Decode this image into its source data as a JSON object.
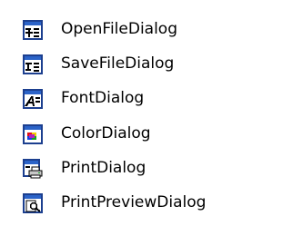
{
  "toolbox": {
    "items": [
      {
        "label": "OpenFileDialog",
        "icon": "open-file-dialog-icon"
      },
      {
        "label": "SaveFileDialog",
        "icon": "save-file-dialog-icon"
      },
      {
        "label": "FontDialog",
        "icon": "font-dialog-icon"
      },
      {
        "label": "ColorDialog",
        "icon": "color-dialog-icon"
      },
      {
        "label": "PrintDialog",
        "icon": "print-dialog-icon"
      },
      {
        "label": "PrintPreviewDialog",
        "icon": "print-preview-dialog-icon"
      }
    ]
  },
  "colors": {
    "background": "#ffffff",
    "text": "#000000",
    "icon_frame": "#1c3f8f",
    "icon_title_bar": "#2b63c8"
  }
}
